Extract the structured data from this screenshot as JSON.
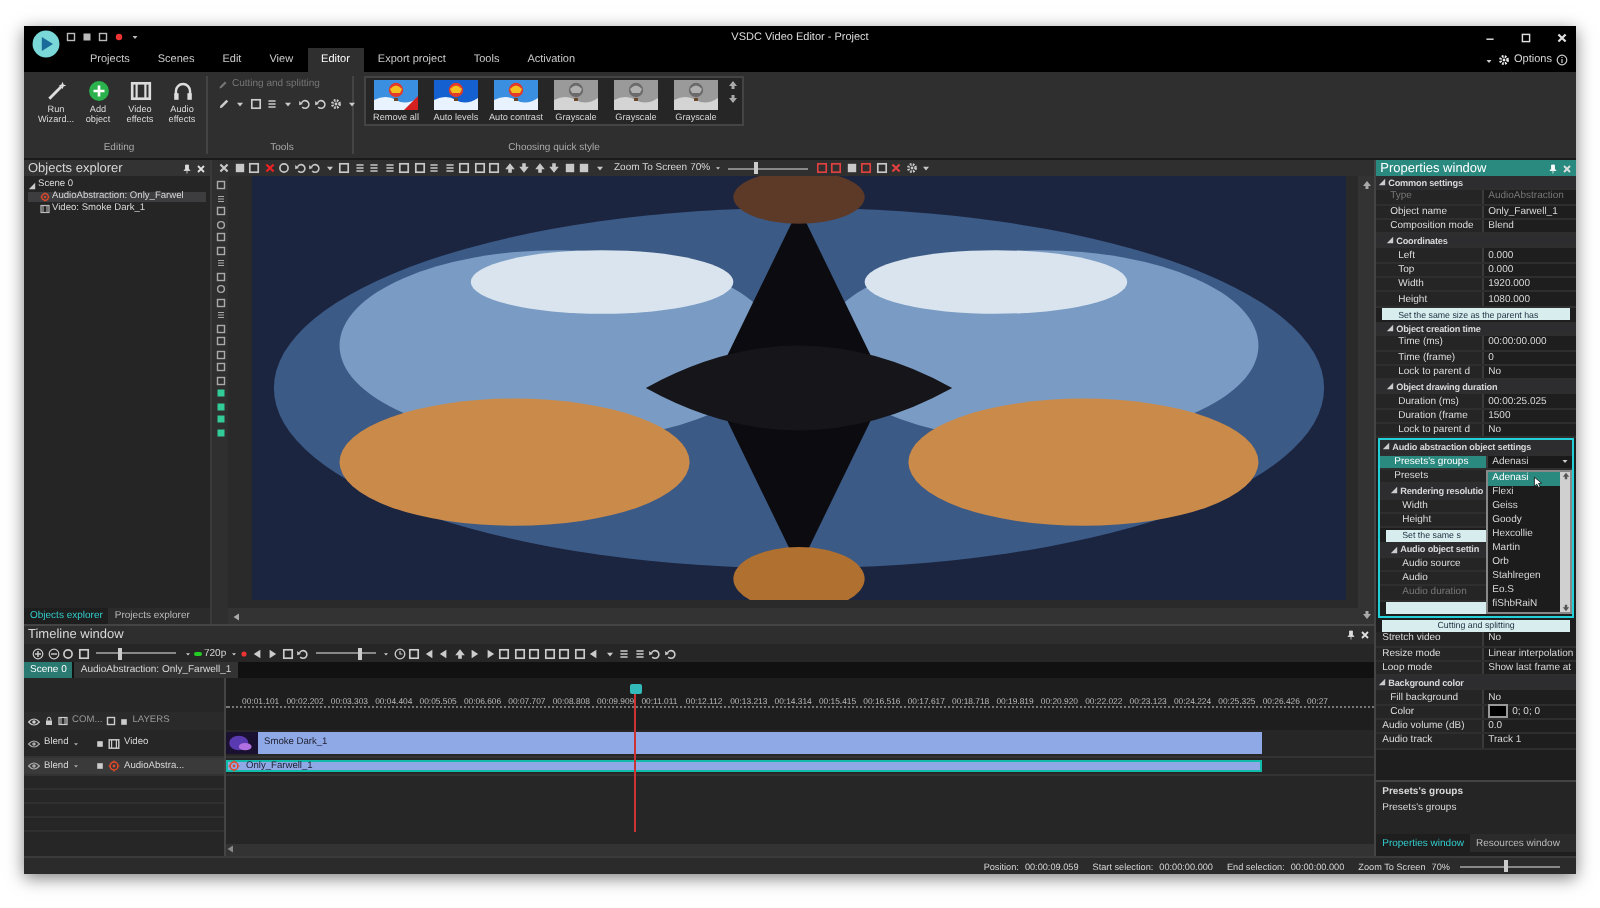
{
  "window": {
    "title": "VSDC Video Editor - Project",
    "options": "Options"
  },
  "menu_tabs": [
    {
      "label": "Projects",
      "selected": false
    },
    {
      "label": "Scenes",
      "selected": false
    },
    {
      "label": "Edit",
      "selected": false
    },
    {
      "label": "View",
      "selected": false
    },
    {
      "label": "Editor",
      "selected": true
    },
    {
      "label": "Export project",
      "selected": false
    },
    {
      "label": "Tools",
      "selected": false
    },
    {
      "label": "Activation",
      "selected": false
    }
  ],
  "ribbon": {
    "editing": {
      "title": "Editing",
      "buttons": [
        "Run Wizard...",
        "Add object",
        "Video effects",
        "Audio effects"
      ]
    },
    "tools": {
      "title": "Tools",
      "label": "Cutting and splitting",
      "disabled": true
    },
    "quick_style": {
      "title": "Choosing quick style",
      "styles": [
        {
          "label": "Remove all",
          "kind": "remove"
        },
        {
          "label": "Auto levels",
          "kind": "levels"
        },
        {
          "label": "Auto contrast",
          "kind": "contrast"
        },
        {
          "label": "Grayscale",
          "kind": "grayscale"
        },
        {
          "label": "Grayscale",
          "kind": "grayscale"
        },
        {
          "label": "Grayscale",
          "kind": "grayscale"
        }
      ]
    }
  },
  "objects_explorer": {
    "title": "Objects explorer",
    "tree": [
      {
        "label": "Scene 0",
        "selected": false,
        "expanded": true,
        "children": [
          {
            "label": "AudioAbstraction: Only_Farwel",
            "selected": true
          },
          {
            "label": "Video: Smoke Dark_1",
            "selected": false
          }
        ]
      }
    ],
    "tabs": [
      {
        "label": "Objects explorer",
        "selected": true
      },
      {
        "label": "Projects explorer",
        "selected": false
      }
    ]
  },
  "toolbar": {
    "zoom": "Zoom To Screen",
    "zoom_level": "70%",
    "zoom_slider": {
      "level": 0.35
    }
  },
  "timeline": {
    "title": "Timeline window",
    "resolution": "720p",
    "zoom_slider": {
      "level": 0.3
    },
    "volume_slider": {
      "level": 0.75
    },
    "scene_tabs": [
      {
        "label": "Scene 0",
        "selected": true
      },
      {
        "label": "AudioAbstraction: Only_Farwell_1",
        "selected": false
      }
    ],
    "composition_label": "COM...",
    "layers_label": "LAYERS",
    "ruler": [
      "00:01.101",
      "00:02.202",
      "00:03.303",
      "00:04.404",
      "00:05.505",
      "00:06.606",
      "00:07.707",
      "00:08.808",
      "00:09.909",
      "00:11.011",
      "00:12.112",
      "00:13.213",
      "00:14.314",
      "00:15.415",
      "00:16.516",
      "00:17.617",
      "00:18.718",
      "00:19.819",
      "00:20.920",
      "00:22.022",
      "00:23.123",
      "00:24.224",
      "00:25.325",
      "00:26.426",
      "00:27"
    ],
    "playhead": {
      "level": 0.357
    },
    "tracks": [
      {
        "kind": "video",
        "blend": "Blend",
        "label": "Video",
        "selected": false,
        "clip": "Smoke Dark_1"
      },
      {
        "kind": "audio",
        "blend": "Blend",
        "label": "AudioAbstra...",
        "selected": true,
        "clip": "Only_Farwell_1"
      }
    ]
  },
  "properties": {
    "title": "Properties window",
    "sections": [
      {
        "kind": "group",
        "label": "Common settings",
        "expanded": true,
        "children": [
          {
            "kind": "row",
            "label": "Type",
            "value": "AudioAbstraction",
            "disabled": true
          },
          {
            "kind": "row",
            "label": "Object name",
            "value": "Only_Farwell_1"
          },
          {
            "kind": "row",
            "label": "Composition mode",
            "value": "Blend"
          },
          {
            "kind": "group",
            "label": "Coordinates",
            "expanded": true,
            "children": [
              {
                "kind": "row",
                "label": "Left",
                "value": "0.000"
              },
              {
                "kind": "row",
                "label": "Top",
                "value": "0.000"
              },
              {
                "kind": "row",
                "label": "Width",
                "value": "1920.000"
              },
              {
                "kind": "row",
                "label": "Height",
                "value": "1080.000"
              },
              {
                "kind": "button",
                "label": "Set the same size as the parent has"
              }
            ]
          },
          {
            "kind": "group",
            "label": "Object creation time",
            "expanded": true,
            "children": [
              {
                "kind": "row",
                "label": "Time (ms)",
                "value": "00:00:00.000"
              },
              {
                "kind": "row",
                "label": "Time (frame)",
                "value": "0"
              },
              {
                "kind": "row",
                "label": "Lock to parent d",
                "value": "No"
              }
            ]
          },
          {
            "kind": "group",
            "label": "Object drawing duration",
            "expanded": true,
            "children": [
              {
                "kind": "row",
                "label": "Duration (ms)",
                "value": "00:00:25.025"
              },
              {
                "kind": "row",
                "label": "Duration (frame",
                "value": "1500"
              },
              {
                "kind": "row",
                "label": "Lock to parent d",
                "value": "No"
              }
            ]
          }
        ]
      },
      {
        "kind": "group",
        "label": "Audio abstraction object settings",
        "expanded": true,
        "highlighted": true,
        "children": [
          {
            "kind": "row",
            "label": "Presets's groups",
            "value": "Adenasi",
            "selected": true,
            "dropdown": {
              "expanded": true,
              "items": [
                {
                  "label": "Adenasi",
                  "selected": true
                },
                {
                  "label": "Flexi",
                  "selected": false
                },
                {
                  "label": "Geiss",
                  "selected": false
                },
                {
                  "label": "Goody",
                  "selected": false
                },
                {
                  "label": "Hexcollie",
                  "selected": false
                },
                {
                  "label": "Martin",
                  "selected": false
                },
                {
                  "label": "Orb",
                  "selected": false
                },
                {
                  "label": "Stahlregen",
                  "selected": false
                },
                {
                  "label": "Eo.S",
                  "selected": false
                },
                {
                  "label": "fiShbRaiN",
                  "selected": false
                }
              ]
            }
          },
          {
            "kind": "row",
            "label": "Presets"
          },
          {
            "kind": "group",
            "label": "Rendering resolutio",
            "expanded": true,
            "children": [
              {
                "kind": "row",
                "label": "Width"
              },
              {
                "kind": "row",
                "label": "Height"
              },
              {
                "kind": "button",
                "label": "Set the same s"
              }
            ]
          },
          {
            "kind": "group",
            "label": "Audio object settin",
            "expanded": true,
            "children": [
              {
                "kind": "row",
                "label": "Audio source"
              },
              {
                "kind": "row",
                "label": "Audio"
              },
              {
                "kind": "row",
                "label": "Audio duration",
                "disabled": true
              },
              {
                "kind": "button"
              }
            ]
          }
        ]
      },
      {
        "kind": "button",
        "label": "Cutting and splitting"
      },
      {
        "kind": "row",
        "label": "Stretch video",
        "value": "No"
      },
      {
        "kind": "row",
        "label": "Resize mode",
        "value": "Linear interpolation"
      },
      {
        "kind": "row",
        "label": "Loop mode",
        "value": "Show last frame at"
      },
      {
        "kind": "group",
        "label": "Background color",
        "expanded": true,
        "children": [
          {
            "kind": "row",
            "label": "Fill background",
            "value": "No"
          },
          {
            "kind": "color",
            "label": "Color",
            "value": "0; 0; 0",
            "color": "#000000"
          }
        ]
      },
      {
        "kind": "row",
        "label": "Audio volume (dB)",
        "value": "0.0"
      },
      {
        "kind": "row",
        "label": "Audio track",
        "value": "Track 1"
      }
    ],
    "description": {
      "title": "Presets's groups",
      "text": "Presets's groups"
    },
    "tabs": [
      {
        "label": "Properties window",
        "selected": true
      },
      {
        "label": "Resources window",
        "selected": false
      }
    ]
  },
  "status_bar": {
    "items": [
      {
        "label": "Position:",
        "value": "00:00:09.059"
      },
      {
        "label": "Start selection:",
        "value": "00:00:00.000"
      },
      {
        "label": "End selection:",
        "value": "00:00:00.000"
      }
    ],
    "zoom": "Zoom To Screen",
    "zoom_level": "70%",
    "zoom_slider": {
      "level": 0.45
    }
  }
}
